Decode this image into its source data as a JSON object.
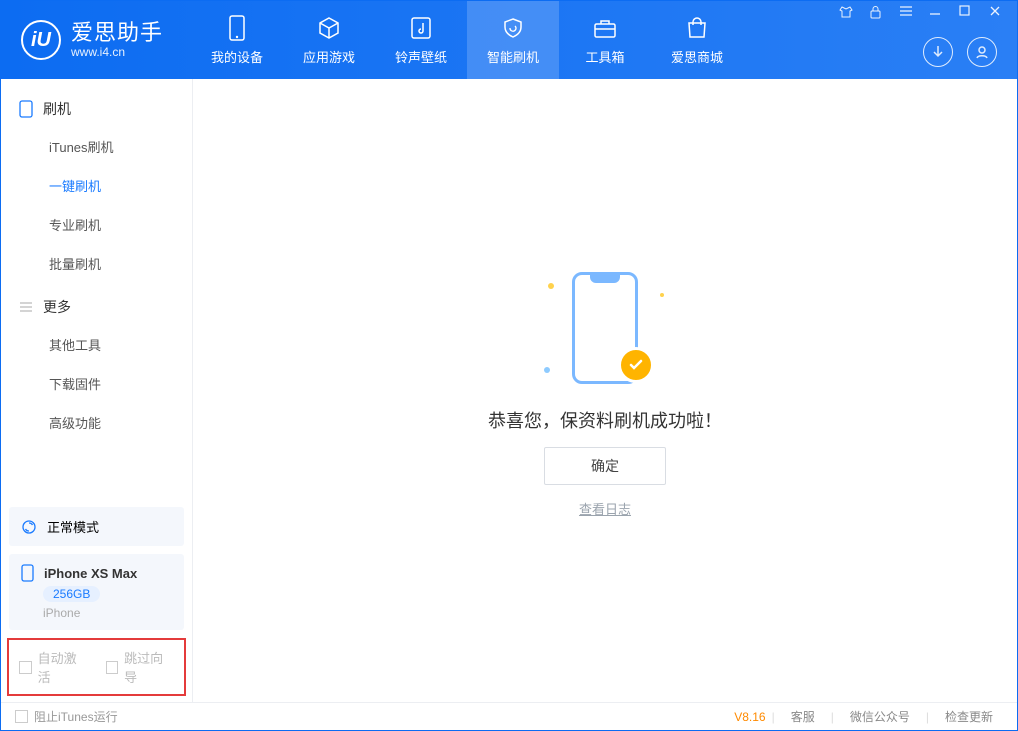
{
  "logo": {
    "title": "爱思助手",
    "subtitle": "www.i4.cn"
  },
  "nav": {
    "tabs": [
      {
        "label": "我的设备"
      },
      {
        "label": "应用游戏"
      },
      {
        "label": "铃声壁纸"
      },
      {
        "label": "智能刷机"
      },
      {
        "label": "工具箱"
      },
      {
        "label": "爱思商城"
      }
    ],
    "active_index": 3
  },
  "sidebar": {
    "group1": {
      "title": "刷机",
      "items": [
        {
          "label": "iTunes刷机"
        },
        {
          "label": "一键刷机"
        },
        {
          "label": "专业刷机"
        },
        {
          "label": "批量刷机"
        }
      ],
      "active_index": 1
    },
    "group2": {
      "title": "更多",
      "items": [
        {
          "label": "其他工具"
        },
        {
          "label": "下载固件"
        },
        {
          "label": "高级功能"
        }
      ]
    },
    "mode": "正常模式",
    "device": {
      "name": "iPhone XS Max",
      "storage": "256GB",
      "type": "iPhone"
    },
    "checks": {
      "auto_activate": "自动激活",
      "skip_guide": "跳过向导"
    }
  },
  "main": {
    "success_message": "恭喜您，保资料刷机成功啦！",
    "ok_button": "确定",
    "view_log": "查看日志"
  },
  "statusbar": {
    "block_itunes": "阻止iTunes运行",
    "version": "V8.16",
    "links": {
      "support": "客服",
      "wechat": "微信公众号",
      "update": "检查更新"
    }
  }
}
